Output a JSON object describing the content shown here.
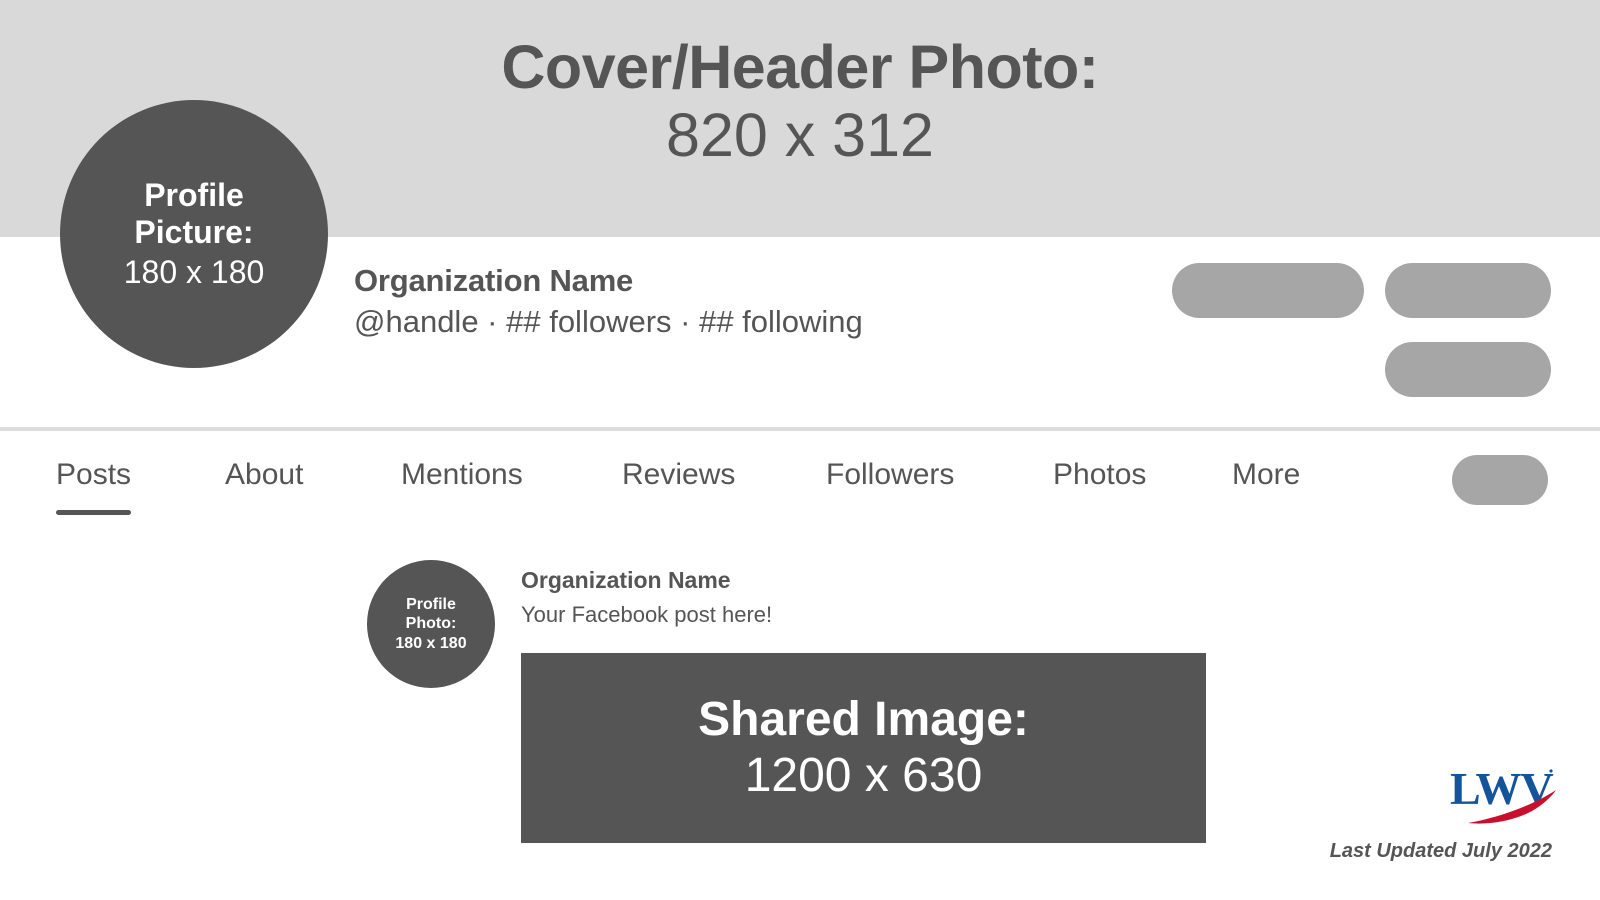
{
  "cover": {
    "title": "Cover/Header Photo:",
    "dimensions": "820 x 312",
    "bg_color": "#d9d9d9"
  },
  "profile_picture": {
    "line1": "Profile",
    "line2": "Picture:",
    "dimensions": "180 x 180",
    "bg_color": "#555555"
  },
  "identity": {
    "org_name": "Organization Name",
    "meta": "@handle · ## followers · ## following"
  },
  "action_placeholders": [
    {
      "name": "primary-action-placeholder"
    },
    {
      "name": "secondary-action-placeholder"
    },
    {
      "name": "tertiary-action-placeholder"
    }
  ],
  "nav": {
    "tabs": [
      {
        "label": "Posts",
        "active": true
      },
      {
        "label": "About",
        "active": false
      },
      {
        "label": "Mentions",
        "active": false
      },
      {
        "label": "Reviews",
        "active": false
      },
      {
        "label": "Followers",
        "active": false
      },
      {
        "label": "Photos",
        "active": false
      },
      {
        "label": "More",
        "active": false
      }
    ],
    "overflow_placeholder": "nav-action-placeholder"
  },
  "post": {
    "avatar": {
      "line1": "Profile",
      "line2": "Photo:",
      "dimensions": "180 x 180"
    },
    "author": "Organization Name",
    "text": "Your Facebook post here!",
    "shared_image": {
      "title": "Shared Image:",
      "dimensions": "1200 x 630",
      "bg_color": "#555555"
    }
  },
  "branding": {
    "logo_text": "LWV",
    "logo_blue": "#14549b",
    "logo_red": "#c8102e",
    "footer_note": "Last Updated July 2022"
  },
  "colors": {
    "placeholder_gray": "#a6a6a6",
    "divider_gray": "#dcdcdc",
    "dark_gray": "#555555",
    "cover_gray": "#d9d9d9"
  }
}
